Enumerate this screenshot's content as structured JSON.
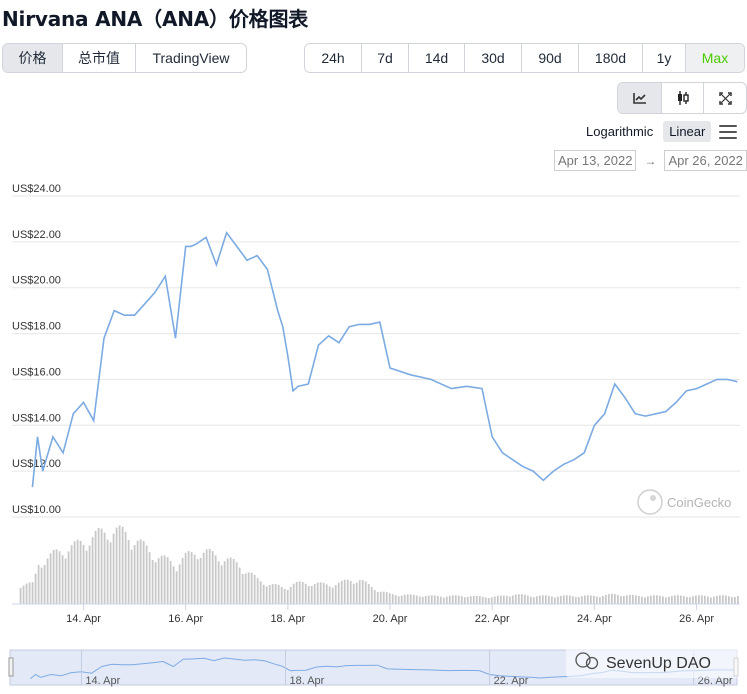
{
  "page": {
    "title": "Nirvana ANA（ANA）价格图表"
  },
  "view_tabs": [
    {
      "label": "价格",
      "active": true
    },
    {
      "label": "总市值",
      "active": false
    },
    {
      "label": "TradingView",
      "active": false
    }
  ],
  "range_tabs": [
    {
      "label": "24h"
    },
    {
      "label": "7d"
    },
    {
      "label": "14d"
    },
    {
      "label": "30d"
    },
    {
      "label": "90d"
    },
    {
      "label": "180d"
    },
    {
      "label": "1y"
    },
    {
      "label": "Max",
      "active": true
    }
  ],
  "chart_type_icons": [
    "line-chart-icon",
    "candlestick-icon",
    "fullscreen-icon"
  ],
  "scale": {
    "logarithmic": "Logarithmic",
    "linear": "Linear",
    "selected": "Linear"
  },
  "date_range": {
    "from": "Apr 13, 2022",
    "to": "Apr 26, 2022"
  },
  "watermark": "CoinGecko",
  "overlay_watermark": "SevenUp DAO",
  "colors": {
    "line": "#7cabe3",
    "volume": "#c8c8c8",
    "accent_green": "#4bcc00",
    "navigator_bg": "#e3e9f7"
  },
  "chart_data": {
    "type": "line",
    "title": "",
    "xlabel": "",
    "ylabel": "",
    "yticks": [
      "US$10.00",
      "US$12.00",
      "US$14.00",
      "US$16.00",
      "US$18.00",
      "US$20.00",
      "US$22.00",
      "US$24.00"
    ],
    "ylim": [
      10,
      24
    ],
    "xticks": [
      "14. Apr",
      "16. Apr",
      "18. Apr",
      "20. Apr",
      "22. Apr",
      "24. Apr",
      "26. Apr"
    ],
    "navigator_ticks": [
      "14. Apr",
      "18. Apr",
      "22. Apr",
      "26. Apr"
    ],
    "x_days": [
      13.0,
      13.1,
      13.2,
      13.4,
      13.6,
      13.8,
      14.0,
      14.2,
      14.4,
      14.6,
      14.8,
      15.0,
      15.2,
      15.4,
      15.6,
      15.8,
      16.0,
      16.1,
      16.2,
      16.4,
      16.6,
      16.8,
      17.0,
      17.2,
      17.4,
      17.6,
      17.8,
      17.9,
      18.0,
      18.1,
      18.2,
      18.4,
      18.6,
      18.8,
      19.0,
      19.2,
      19.4,
      19.6,
      19.8,
      20.0,
      20.4,
      20.8,
      21.2,
      21.5,
      21.8,
      22.0,
      22.2,
      22.4,
      22.6,
      22.8,
      23.0,
      23.2,
      23.4,
      23.6,
      23.8,
      24.0,
      24.2,
      24.4,
      24.6,
      24.8,
      25.0,
      25.2,
      25.4,
      25.6,
      25.8,
      26.0,
      26.2,
      26.4,
      26.6,
      26.8
    ],
    "prices": [
      11.3,
      13.5,
      12.0,
      13.5,
      12.8,
      14.5,
      15.0,
      14.2,
      17.8,
      19.0,
      18.8,
      18.8,
      19.3,
      19.8,
      20.5,
      17.8,
      21.8,
      21.8,
      21.9,
      22.2,
      21.0,
      22.4,
      21.8,
      21.2,
      21.4,
      20.8,
      19.0,
      18.3,
      17.0,
      15.5,
      15.7,
      15.8,
      17.5,
      17.9,
      17.6,
      18.3,
      18.4,
      18.4,
      18.5,
      16.5,
      16.2,
      16.0,
      15.6,
      15.7,
      15.6,
      13.5,
      12.8,
      12.5,
      12.2,
      12.0,
      11.6,
      12.0,
      12.3,
      12.5,
      12.8,
      14.0,
      14.5,
      15.8,
      15.2,
      14.5,
      14.4,
      14.5,
      14.6,
      15.0,
      15.5,
      15.6,
      15.8,
      16.0,
      16.0,
      15.9
    ],
    "volume_relative": [
      0.25,
      0.5,
      0.55,
      0.62,
      0.68,
      0.72,
      0.78,
      0.85,
      0.9,
      0.92,
      0.88,
      0.8,
      0.7,
      0.6,
      0.55,
      0.5,
      0.6,
      0.62,
      0.66,
      0.64,
      0.6,
      0.55,
      0.5,
      0.4,
      0.3,
      0.25,
      0.22,
      0.2,
      0.22,
      0.25,
      0.26,
      0.26,
      0.25,
      0.24,
      0.26,
      0.3,
      0.3,
      0.22,
      0.16,
      0.12,
      0.11,
      0.1,
      0.1,
      0.1,
      0.09,
      0.09,
      0.1,
      0.12,
      0.11,
      0.1,
      0.1,
      0.1,
      0.1,
      0.1,
      0.1,
      0.1,
      0.11,
      0.12,
      0.11,
      0.1,
      0.1,
      0.1,
      0.1,
      0.1,
      0.1,
      0.1,
      0.1,
      0.1,
      0.1,
      0.1
    ],
    "grid": true
  }
}
